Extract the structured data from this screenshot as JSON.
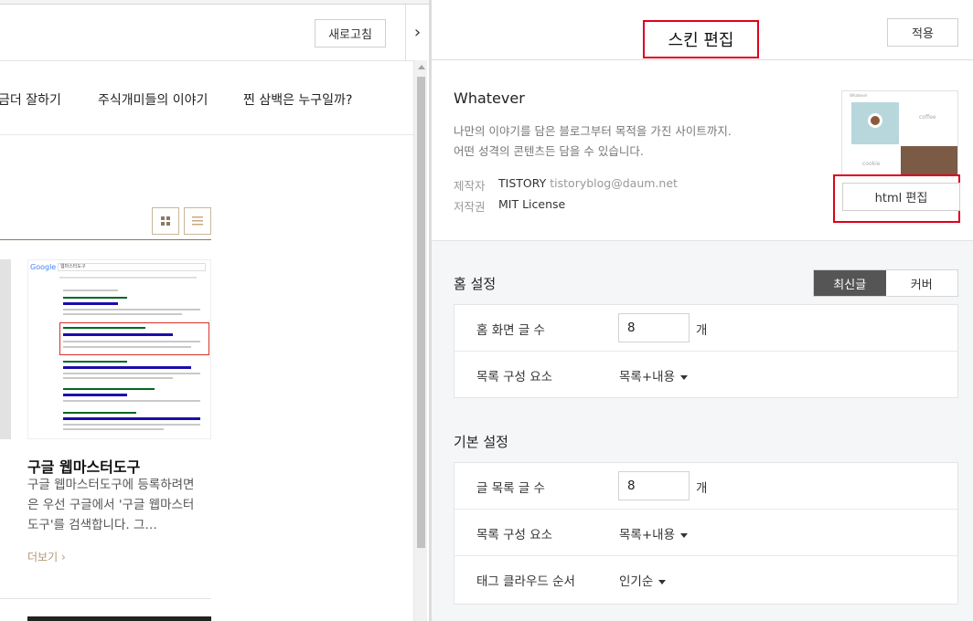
{
  "preview": {
    "refresh_label": "새로고침",
    "nav": [
      "금더 잘하기",
      "주식개미들의 이야기",
      "찐 삼백은 누구일까?"
    ],
    "thumb": {
      "logo": "Google",
      "query": "웹마스터도구",
      "result_title": "구글 웹마스터 도구 - Google Search Console"
    },
    "post": {
      "title": "구글 웹마스터도구",
      "excerpt": "구글 웹마스터도구에 등록하려면은 우선 구글에서 '구글 웹마스터도구'를 검색합니다. 그…",
      "more": "더보기"
    }
  },
  "editor": {
    "title": "스킨 편집",
    "apply_label": "적용",
    "skin": {
      "name": "Whatever",
      "desc_line1": "나만의 이야기를 담은 블로그부터 목적을 가진 사이트까지.",
      "desc_line2": "어떤 성격의 콘텐츠든 담을 수 있습니다.",
      "maker_label": "제작자",
      "maker": "TISTORY",
      "maker_email": "tistoryblog@daum.net",
      "license_label": "저작권",
      "license": "MIT License",
      "thumb_logo": "Whatever",
      "thumb_coffee": "coffee",
      "thumb_cookie": "cookie",
      "html_edit_label": "html 편집"
    },
    "home": {
      "title": "홈 설정",
      "seg_on": "최신글",
      "seg_off": "커버",
      "rows": {
        "count_label": "홈 화면 글 수",
        "count_value": "8",
        "count_unit": "개",
        "compose_label": "목록 구성 요소",
        "compose_value": "목록+내용"
      }
    },
    "basic": {
      "title": "기본 설정",
      "rows": {
        "count_label": "글 목록 글 수",
        "count_value": "8",
        "count_unit": "개",
        "compose_label": "목록 구성 요소",
        "compose_value": "목록+내용",
        "tag_label": "태그 클라우드 순서",
        "tag_value": "인기순"
      }
    }
  }
}
